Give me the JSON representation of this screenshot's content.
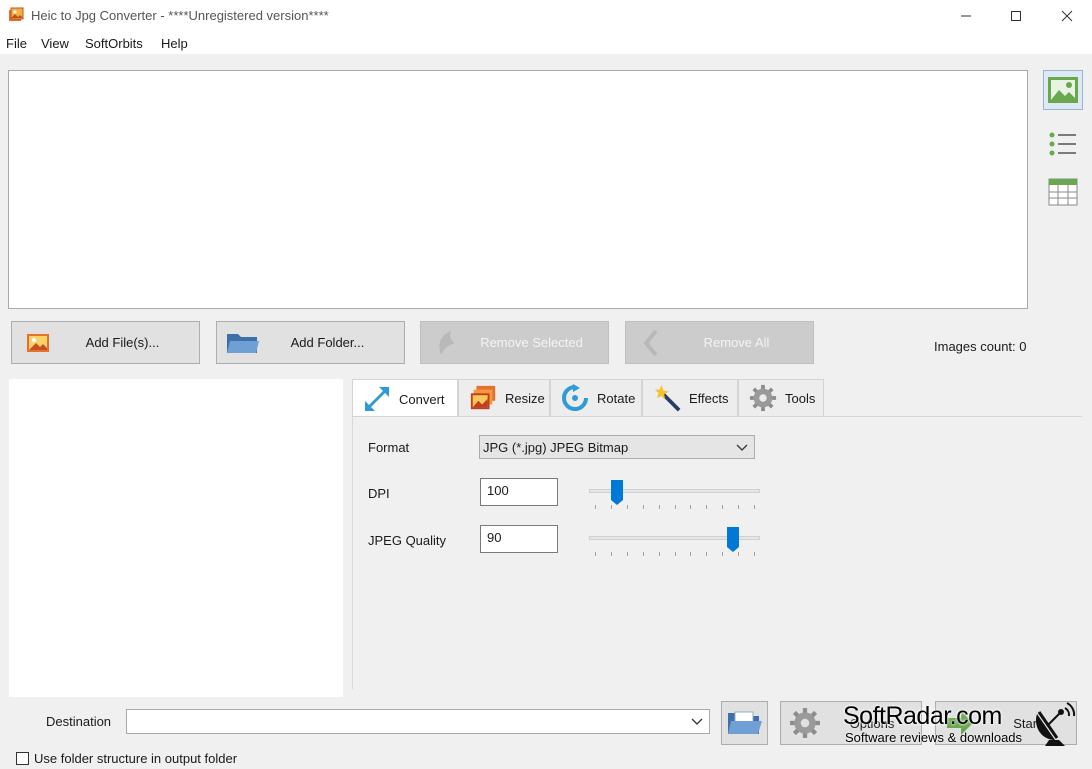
{
  "window": {
    "title": "Heic to Jpg Converter - ****Unregistered version****",
    "controls": [
      "minimize-icon",
      "maximize-icon",
      "close-icon"
    ]
  },
  "menu": [
    "File",
    "View",
    "SoftOrbits",
    "Help"
  ],
  "view_modes": [
    "thumbnails-icon",
    "list-icon",
    "table-icon"
  ],
  "actions": {
    "add_files": "Add File(s)...",
    "add_folder": "Add Folder...",
    "remove_selected": "Remove Selected",
    "remove_all": "Remove All",
    "images_count": "Images count: 0"
  },
  "tabs": [
    {
      "label": "Convert",
      "icon": "convert-arrows-icon",
      "active": true
    },
    {
      "label": "Resize",
      "icon": "resize-photos-icon",
      "active": false
    },
    {
      "label": "Rotate",
      "icon": "rotate-icon",
      "active": false
    },
    {
      "label": "Effects",
      "icon": "magic-wand-icon",
      "active": false
    },
    {
      "label": "Tools",
      "icon": "gear-icon",
      "active": false
    }
  ],
  "convert": {
    "format_label": "Format",
    "format_value": "JPG (*.jpg) JPEG Bitmap",
    "dpi_label": "DPI",
    "dpi_value": "100",
    "dpi_slider_fraction": 0.14,
    "quality_label": "JPEG Quality",
    "quality_value": "90",
    "quality_slider_fraction": 0.87
  },
  "bottom": {
    "destination_label": "Destination",
    "destination_value": "",
    "options_label": "Options",
    "start_label": "Start",
    "use_folder_structure": "Use folder structure in output folder",
    "use_folder_structure_checked": false
  },
  "watermark": {
    "title": "SoftRadar.com",
    "subtitle": "Software reviews & downloads"
  },
  "colors": {
    "accent": "#0078d7",
    "thumb_view_green": "#6aa84f"
  }
}
